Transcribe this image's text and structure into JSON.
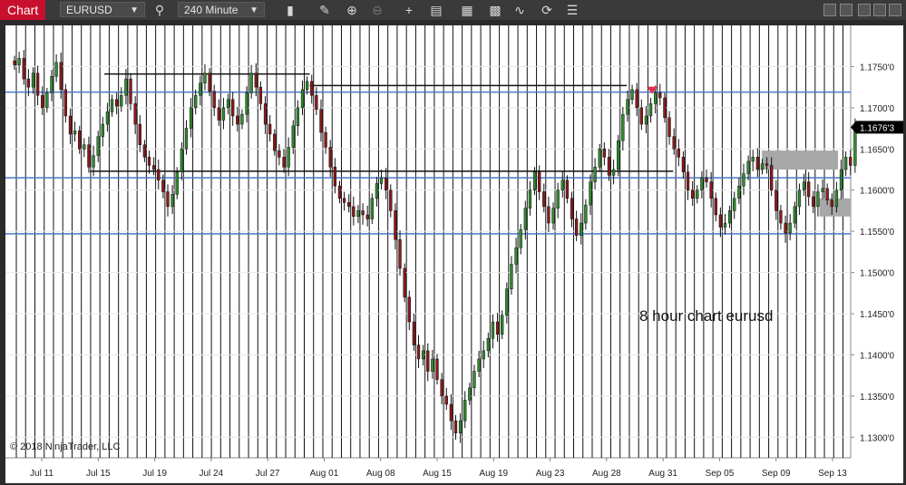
{
  "toolbar": {
    "title": "Chart",
    "instrument": "EURUSD",
    "interval": "240 Minute"
  },
  "chart_data": {
    "type": "candlestick",
    "xlabels": [
      "Jul 11",
      "Jul 15",
      "Jul 19",
      "Jul 24",
      "Jul 27",
      "Aug 01",
      "Aug 08",
      "Aug 15",
      "Aug 19",
      "Aug 23",
      "Aug 28",
      "Aug 31",
      "Sep 05",
      "Sep 09",
      "Sep 13"
    ],
    "ylabels": [
      "1.1750'0",
      "1.1700'0",
      "1.1650'0",
      "1.1600'0",
      "1.1550'0",
      "1.1500'0",
      "1.1450'0",
      "1.1400'0",
      "1.1350'0",
      "1.1300'0"
    ],
    "yticks": [
      1.175,
      1.17,
      1.165,
      1.16,
      1.155,
      1.15,
      1.145,
      1.14,
      1.135,
      1.13
    ],
    "ylim": [
      1.1275,
      1.18
    ],
    "last_price_label": "1.1676'3",
    "last_price": 1.16763,
    "annotation": "8 hour chart eurusd",
    "copyright": "© 2018 NinjaTrader, LLC",
    "hlines": [
      1.1719,
      1.1615,
      1.1547
    ],
    "trend_segments": [
      {
        "x1": 0.117,
        "x2": 0.36,
        "y": 1.1741
      },
      {
        "x1": 0.1,
        "x2": 0.79,
        "y": 1.1623
      },
      {
        "x1": 0.36,
        "x2": 0.735,
        "y": 1.1727
      }
    ],
    "zones": [
      {
        "x1": 0.895,
        "x2": 0.985,
        "y1": 1.1625,
        "y2": 1.1648
      },
      {
        "x1": 0.963,
        "x2": 1.0,
        "y1": 1.1568,
        "y2": 1.159
      }
    ],
    "closes": [
      1.1752,
      1.176,
      1.1735,
      1.1725,
      1.1742,
      1.1715,
      1.17,
      1.1718,
      1.1738,
      1.1755,
      1.1722,
      1.169,
      1.1668,
      1.1672,
      1.165,
      1.1655,
      1.1628,
      1.1642,
      1.1665,
      1.168,
      1.1695,
      1.171,
      1.1702,
      1.1715,
      1.1735,
      1.1705,
      1.168,
      1.1655,
      1.164,
      1.163,
      1.1625,
      1.1612,
      1.1598,
      1.158,
      1.1595,
      1.1622,
      1.165,
      1.1675,
      1.17,
      1.1715,
      1.173,
      1.1742,
      1.172,
      1.17,
      1.1685,
      1.17,
      1.171,
      1.169,
      1.168,
      1.1692,
      1.1718,
      1.1742,
      1.1725,
      1.1705,
      1.168,
      1.1668,
      1.1648,
      1.164,
      1.1628,
      1.1652,
      1.1678,
      1.17,
      1.1722,
      1.1732,
      1.1715,
      1.1698,
      1.167,
      1.1652,
      1.1628,
      1.1605,
      1.159,
      1.1585,
      1.158,
      1.1568,
      1.1575,
      1.157,
      1.1565,
      1.159,
      1.1608,
      1.1615,
      1.16,
      1.1575,
      1.154,
      1.1505,
      1.147,
      1.144,
      1.1412,
      1.1395,
      1.1405,
      1.138,
      1.1395,
      1.137,
      1.135,
      1.134,
      1.132,
      1.1305,
      1.132,
      1.1345,
      1.136,
      1.138,
      1.1395,
      1.1405,
      1.142,
      1.144,
      1.1425,
      1.1448,
      1.148,
      1.151,
      1.153,
      1.1552,
      1.1578,
      1.16,
      1.1622,
      1.1598,
      1.158,
      1.156,
      1.1578,
      1.16,
      1.1612,
      1.159,
      1.1565,
      1.1545,
      1.156,
      1.1582,
      1.161,
      1.1628,
      1.165,
      1.164,
      1.1618,
      1.1625,
      1.166,
      1.1692,
      1.171,
      1.1722,
      1.17,
      1.168,
      1.169,
      1.1705,
      1.1718,
      1.1712,
      1.1688,
      1.1665,
      1.165,
      1.164,
      1.1622,
      1.16,
      1.159,
      1.16,
      1.1615,
      1.161,
      1.159,
      1.157,
      1.1555,
      1.156,
      1.1575,
      1.159,
      1.1605,
      1.162,
      1.1635,
      1.164,
      1.1625,
      1.1632,
      1.163,
      1.16,
      1.1575,
      1.156,
      1.1548,
      1.156,
      1.158,
      1.16,
      1.161,
      1.1592,
      1.158,
      1.1598,
      1.1602,
      1.1588,
      1.158,
      1.16,
      1.1625,
      1.164,
      1.163,
      1.1676
    ]
  }
}
